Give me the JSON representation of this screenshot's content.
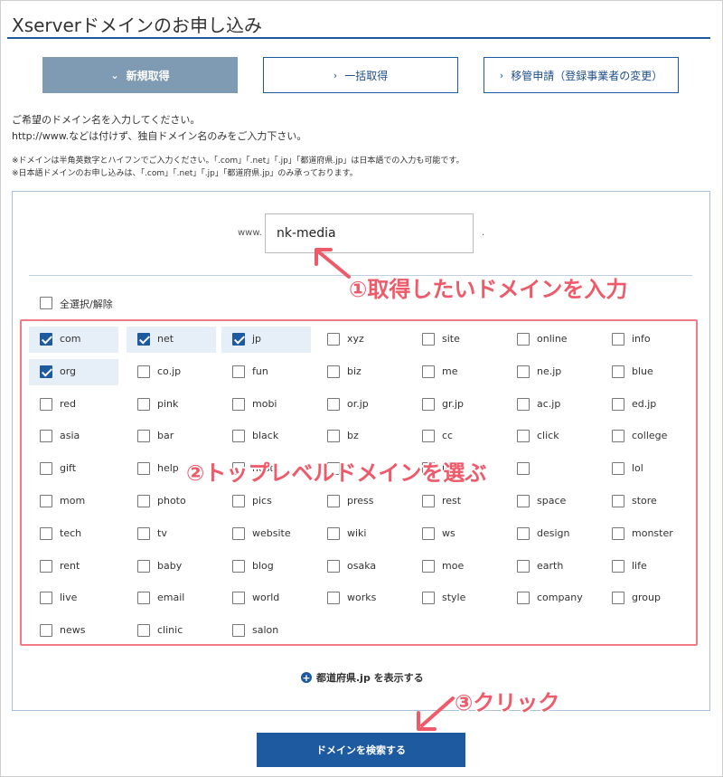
{
  "header": {
    "title": "Xserverドメインのお申し込み"
  },
  "tabs": [
    {
      "label": "新規取得",
      "active": true
    },
    {
      "label": "一括取得",
      "active": false
    },
    {
      "label": "移管申請（登録事業者の変更）",
      "active": false
    }
  ],
  "instructions": {
    "line1": "ご希望のドメイン名を入力してください。",
    "line2": "http://www.などは付けず、独自ドメイン名のみをご入力下さい。",
    "note1": "※ドメインは半角英数字とハイフンでご入力ください。「.com」「.net」「.jp」「都道府県.jp」は日本語での入力も可能です。",
    "note2": "※日本語ドメインのお申し込みは、「.com」「.net」「.jp」「都道府県.jp」のみ承っております。"
  },
  "domain_form": {
    "prefix": "www.",
    "value": "nk-media",
    "suffix": "."
  },
  "select_all": {
    "label": "全選択/解除",
    "checked": false
  },
  "tlds": [
    {
      "label": "com",
      "checked": true
    },
    {
      "label": "net",
      "checked": true
    },
    {
      "label": "jp",
      "checked": true
    },
    {
      "label": "xyz",
      "checked": false
    },
    {
      "label": "site",
      "checked": false
    },
    {
      "label": "online",
      "checked": false
    },
    {
      "label": "info",
      "checked": false
    },
    {
      "label": "org",
      "checked": true
    },
    {
      "label": "co.jp",
      "checked": false
    },
    {
      "label": "fun",
      "checked": false
    },
    {
      "label": "biz",
      "checked": false
    },
    {
      "label": "me",
      "checked": false
    },
    {
      "label": "ne.jp",
      "checked": false
    },
    {
      "label": "blue",
      "checked": false
    },
    {
      "label": "red",
      "checked": false
    },
    {
      "label": "pink",
      "checked": false
    },
    {
      "label": "mobi",
      "checked": false
    },
    {
      "label": "or.jp",
      "checked": false
    },
    {
      "label": "gr.jp",
      "checked": false
    },
    {
      "label": "ac.jp",
      "checked": false
    },
    {
      "label": "ed.jp",
      "checked": false
    },
    {
      "label": "asia",
      "checked": false
    },
    {
      "label": "bar",
      "checked": false
    },
    {
      "label": "black",
      "checked": false
    },
    {
      "label": "bz",
      "checked": false
    },
    {
      "label": "cc",
      "checked": false
    },
    {
      "label": "click",
      "checked": false
    },
    {
      "label": "college",
      "checked": false
    },
    {
      "label": "gift",
      "checked": false
    },
    {
      "label": "help",
      "checked": false
    },
    {
      "label": "host",
      "checked": false
    },
    {
      "label": "",
      "checked": false
    },
    {
      "label": "ink",
      "checked": false
    },
    {
      "label": "",
      "checked": false
    },
    {
      "label": "lol",
      "checked": false
    },
    {
      "label": "mom",
      "checked": false
    },
    {
      "label": "photo",
      "checked": false
    },
    {
      "label": "pics",
      "checked": false
    },
    {
      "label": "press",
      "checked": false
    },
    {
      "label": "rest",
      "checked": false
    },
    {
      "label": "space",
      "checked": false
    },
    {
      "label": "store",
      "checked": false
    },
    {
      "label": "tech",
      "checked": false
    },
    {
      "label": "tv",
      "checked": false
    },
    {
      "label": "website",
      "checked": false
    },
    {
      "label": "wiki",
      "checked": false
    },
    {
      "label": "ws",
      "checked": false
    },
    {
      "label": "design",
      "checked": false
    },
    {
      "label": "monster",
      "checked": false
    },
    {
      "label": "rent",
      "checked": false
    },
    {
      "label": "baby",
      "checked": false
    },
    {
      "label": "blog",
      "checked": false
    },
    {
      "label": "osaka",
      "checked": false
    },
    {
      "label": "moe",
      "checked": false
    },
    {
      "label": "earth",
      "checked": false
    },
    {
      "label": "life",
      "checked": false
    },
    {
      "label": "live",
      "checked": false
    },
    {
      "label": "email",
      "checked": false
    },
    {
      "label": "world",
      "checked": false
    },
    {
      "label": "works",
      "checked": false
    },
    {
      "label": "style",
      "checked": false
    },
    {
      "label": "company",
      "checked": false
    },
    {
      "label": "group",
      "checked": false
    },
    {
      "label": "news",
      "checked": false
    },
    {
      "label": "clinic",
      "checked": false
    },
    {
      "label": "salon",
      "checked": false
    }
  ],
  "prefecture_toggle": {
    "label": "都道府県.jp を表示する"
  },
  "search_button": {
    "label": "ドメインを検索する"
  },
  "annotations": {
    "step1": "①取得したいドメインを入力",
    "step2": "②トップレベルドメインを選ぶ",
    "step3": "③クリック"
  },
  "colors": {
    "accent": "#1e5aa0",
    "annotation": "#ee5a6a",
    "active_tab": "#7f9bb4"
  },
  "icons": {
    "tab_chevron": "chevron-right-icon",
    "active_tab_chevron": "chevron-down-icon",
    "plus": "plus-circle-icon"
  }
}
